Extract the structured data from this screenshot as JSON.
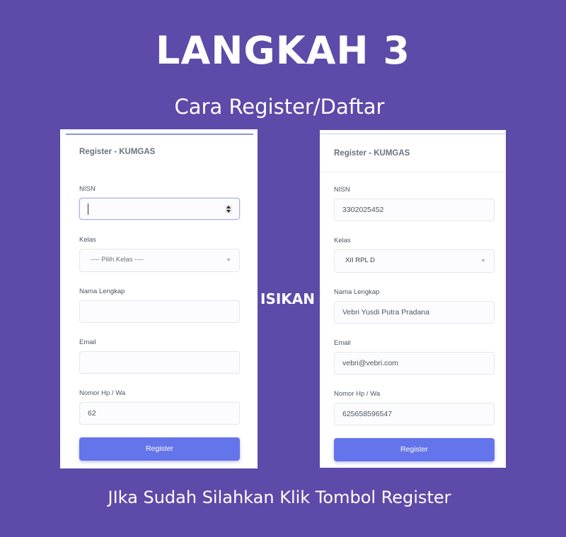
{
  "heading": "LANGKAH 3",
  "subheading": "Cara Register/Daftar",
  "middle_label": "ISIKAN",
  "footer": "JIka Sudah Silahkan Klik Tombol Register",
  "colors": {
    "background": "#5e4aa8",
    "button": "#6474ea",
    "focus_border": "#a9b1ec"
  },
  "left_form": {
    "title": "Register - KUMGAS",
    "nisn_label": "NISN",
    "nisn_value": "",
    "kelas_label": "Kelas",
    "kelas_value": "---- Pilih Kelas ----",
    "nama_label": "Nama Lengkap",
    "nama_value": "",
    "email_label": "Email",
    "email_value": "",
    "hp_label": "Nomor Hp / Wa",
    "hp_value": "62",
    "button_label": "Register"
  },
  "right_form": {
    "title": "Register - KUMGAS",
    "nisn_label": "NISN",
    "nisn_value": "3302025452",
    "kelas_label": "Kelas",
    "kelas_value": "XII RPL D",
    "nama_label": "Nama Lengkap",
    "nama_value": "Vebri Yusdi Putra Pradana",
    "email_label": "Email",
    "email_value": "vebri@vebri.com",
    "hp_label": "Nomor Hp / Wa",
    "hp_value": "625658596547",
    "button_label": "Register"
  }
}
